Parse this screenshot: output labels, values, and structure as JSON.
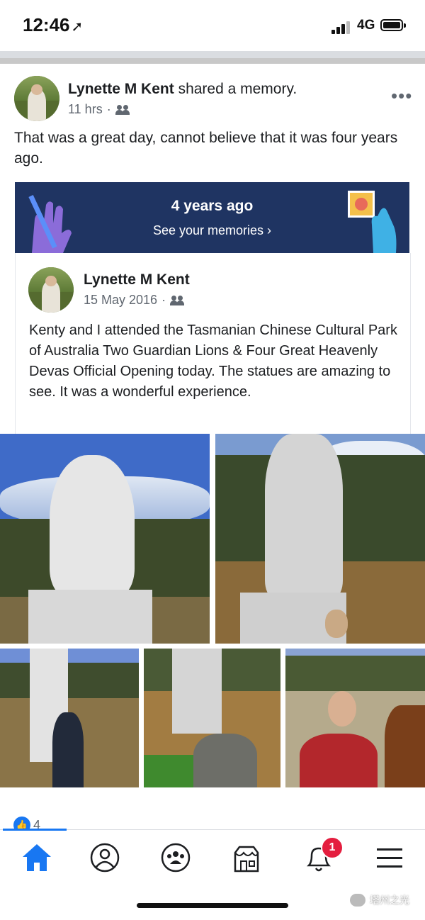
{
  "status_bar": {
    "time": "12:46",
    "network": "4G"
  },
  "post": {
    "author": "Lynette M Kent",
    "action": " shared a memory.",
    "time_ago": "11 hrs",
    "text": "That was a great day, cannot believe that it was four years ago.",
    "more_icon": "more-dots-icon"
  },
  "memory_banner": {
    "title": "4 years ago",
    "link": "See your memories ›"
  },
  "shared_post": {
    "author": "Lynette M Kent",
    "date": "15 May 2016",
    "text": "Kenty and I attended the Tasmanian Chinese Cultural Park of Australia Two Guardian Lions & Four Great Heavenly Devas Official Opening today. The statues are amazing to see. It was a wonderful experience."
  },
  "reactions": {
    "like_count": "4"
  },
  "tabs": [
    {
      "name": "home",
      "icon": "home-icon",
      "active": true
    },
    {
      "name": "profile",
      "icon": "profile-icon"
    },
    {
      "name": "groups",
      "icon": "groups-icon"
    },
    {
      "name": "marketplace",
      "icon": "marketplace-icon"
    },
    {
      "name": "notifications",
      "icon": "bell-icon",
      "badge": "1"
    },
    {
      "name": "menu",
      "icon": "menu-icon"
    }
  ],
  "watermark": {
    "text": "塔州之光"
  },
  "colors": {
    "facebook_blue": "#1877f2",
    "banner_navy": "#1f3462",
    "badge_red": "#e41e3f"
  }
}
